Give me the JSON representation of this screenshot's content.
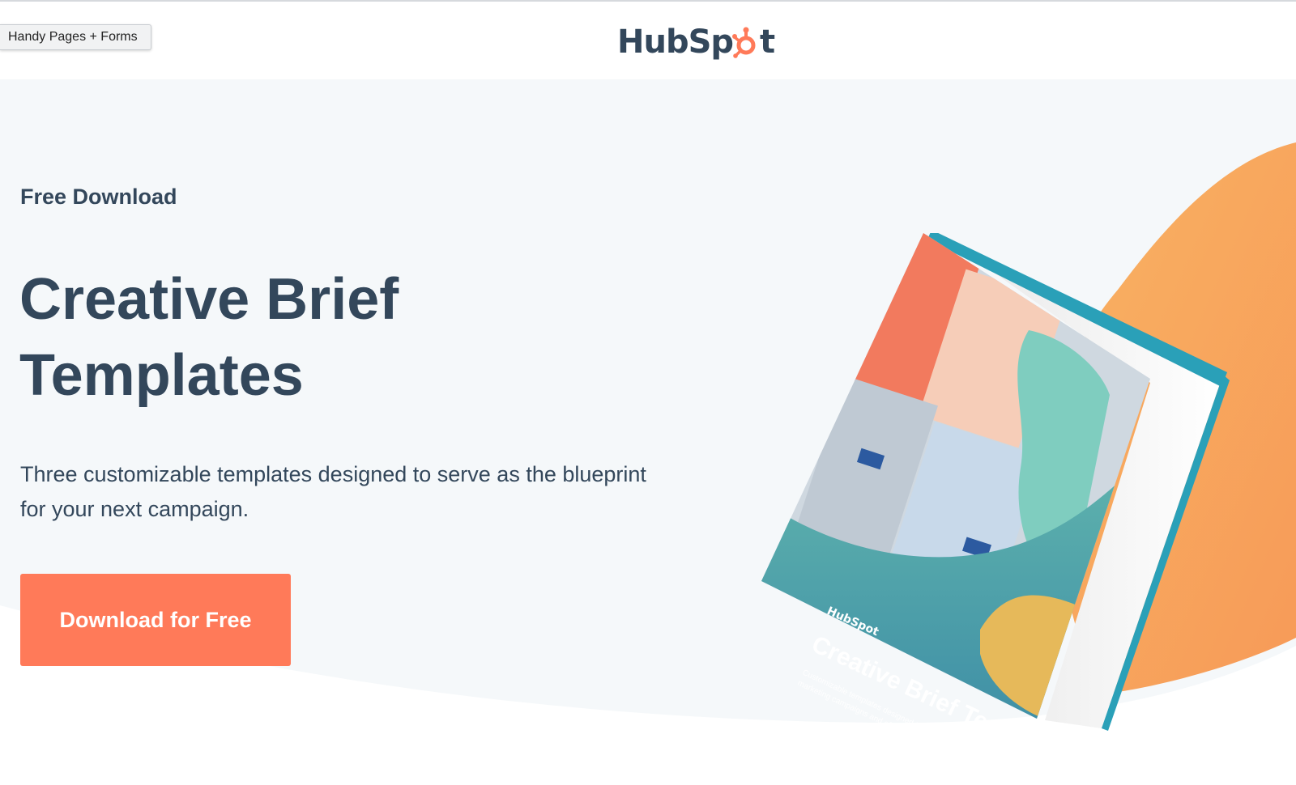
{
  "extension": {
    "label": "Handy Pages + Forms"
  },
  "header": {
    "logo_part1": "HubSp",
    "logo_part2": "t"
  },
  "hero": {
    "eyebrow": "Free Download",
    "title_line1": "Creative Brief",
    "title_line2": "Templates",
    "description_line1": "Three customizable templates designed to serve as the blueprint",
    "description_line2": "for your next campaign.",
    "cta_label": "Download for Free"
  },
  "book": {
    "logo": "HubSpot",
    "title": "Creative Brief Templates",
    "subtitle_line1": "Customizable templates designed to help you plan and manage",
    "subtitle_line2": "marketing campaigns and efforts."
  },
  "colors": {
    "brand_orange": "#ff7a59",
    "text_dark": "#33475b",
    "hero_bg": "#f5f8fa",
    "accent_orange_blob": "#f7a35c",
    "book_teal": "#4aa3a5"
  },
  "icons": {
    "logo_mark": "hubspot-sprocket-icon"
  }
}
